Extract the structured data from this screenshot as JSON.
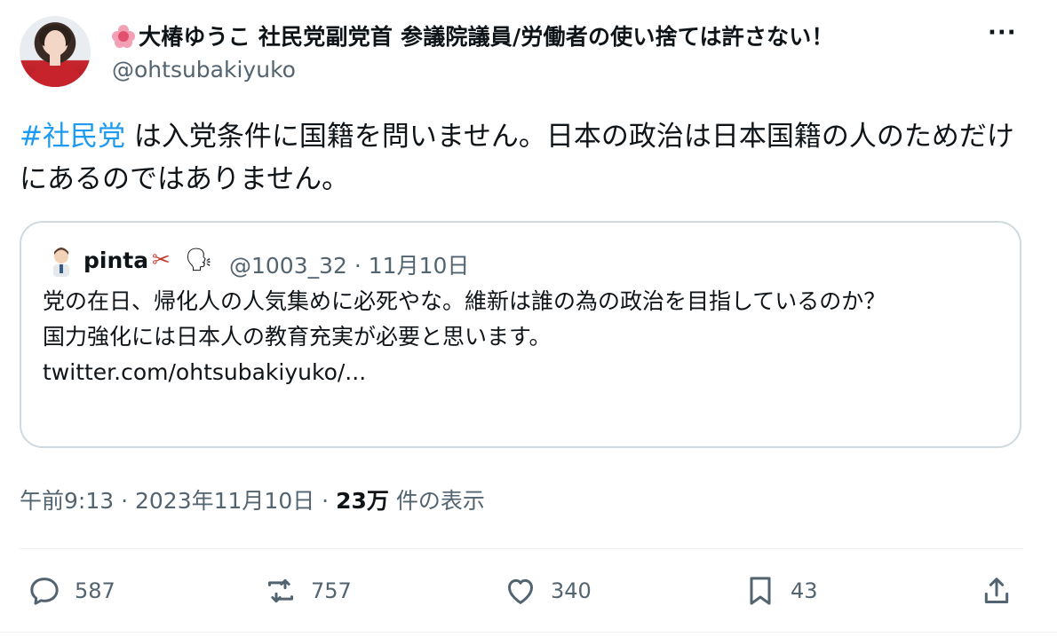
{
  "author": {
    "flower_icon": "hibiscus-emoji",
    "display_name": "大椿ゆうこ 社民党副党首 参議院議員/労働者の使い捨ては許さない！",
    "handle": "@ohtsubakiyuko",
    "more_icon": "more-icon"
  },
  "tweet": {
    "hashtag": "#社民党",
    "text": " は入党条件に国籍を問いません。日本の政治は日本国籍の人のためだけにあるのではありません。"
  },
  "quote": {
    "name": "pinta",
    "emoji1": "✂",
    "emoji2": "🗣",
    "meta": "@1003_32 · 11月10日",
    "line1": "党の在日、帰化人の人気集めに必死やな。維新は誰の為の政治を目指しているのか？",
    "line2": "国力強化には日本人の教育充実が必要と思います。",
    "line3": "twitter.com/ohtsubakiyuko/..."
  },
  "meta": {
    "time": "午前9:13 · 2023年11月10日 · ",
    "views_count": "23万",
    "views_label": " 件の表示"
  },
  "actions": {
    "replies": "587",
    "retweets": "757",
    "likes": "340",
    "bookmarks": "43"
  },
  "colors": {
    "link": "#1d9bf0",
    "secondary_text": "#536471",
    "border": "#cfd9de"
  }
}
